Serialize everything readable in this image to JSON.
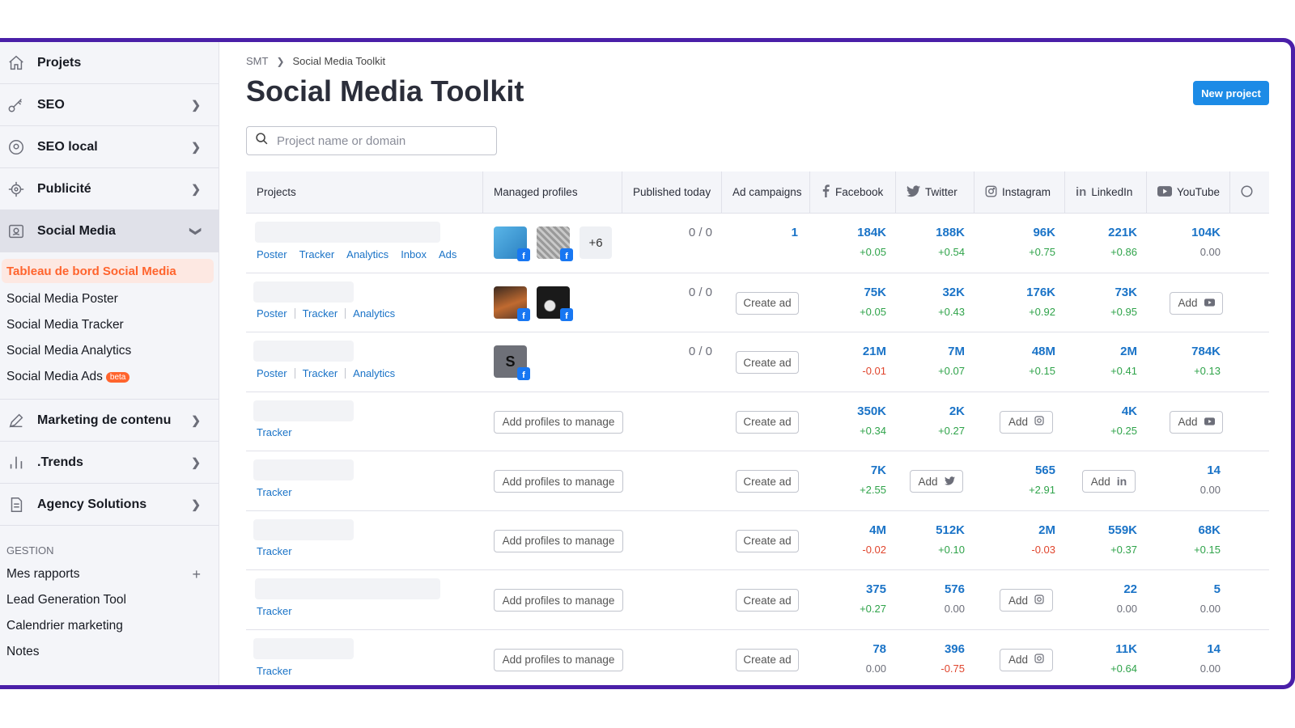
{
  "sidebar": {
    "items": [
      {
        "label": "Projets",
        "icon": "home-icon"
      },
      {
        "label": "SEO",
        "icon": "key-icon"
      },
      {
        "label": "SEO local",
        "icon": "location-pin-icon"
      },
      {
        "label": "Publicité",
        "icon": "target-icon"
      },
      {
        "label": "Social Media",
        "icon": "social-icon"
      }
    ],
    "social_sub": {
      "active": "Tableau de bord Social Media",
      "items": [
        "Social Media Poster",
        "Social Media Tracker",
        "Social Media Analytics",
        "Social Media Ads"
      ],
      "beta": "beta"
    },
    "items2": [
      {
        "label": "Marketing de contenu",
        "icon": "pencil-icon"
      },
      {
        "label": ".Trends",
        "icon": "bars-icon"
      },
      {
        "label": "Agency Solutions",
        "icon": "document-icon"
      }
    ],
    "gestion_label": "GESTION",
    "gestion_items": [
      "Mes rapports",
      "Lead Generation Tool",
      "Calendrier marketing",
      "Notes"
    ]
  },
  "breadcrumb": {
    "root": "SMT",
    "current": "Social Media Toolkit"
  },
  "page_title": "Social Media Toolkit",
  "new_project": "New project",
  "search": {
    "placeholder": "Project name or domain"
  },
  "table": {
    "headers": {
      "projects": "Projects",
      "managed": "Managed profiles",
      "published": "Published today",
      "ads": "Ad campaigns",
      "facebook": "Facebook",
      "twitter": "Twitter",
      "instagram": "Instagram",
      "linkedin": "LinkedIn",
      "youtube": "YouTube"
    },
    "labels": {
      "create_ad": "Create ad",
      "add_profiles": "Add profiles to manage",
      "add": "Add",
      "more": "+6"
    },
    "rows": [
      {
        "links": [
          "Poster",
          "Tracker",
          "Analytics",
          "Inbox",
          "Ads"
        ],
        "published": "0 / 0",
        "ads": "1",
        "fb": [
          "184K",
          "+0.05"
        ],
        "tw": [
          "188K",
          "+0.54"
        ],
        "ig": [
          "96K",
          "+0.75"
        ],
        "li": [
          "221K",
          "+0.86"
        ],
        "yt": [
          "104K",
          "0.00"
        ]
      },
      {
        "links": [
          "Poster",
          "Tracker",
          "Analytics"
        ],
        "published": "0 / 0",
        "fb": [
          "75K",
          "+0.05"
        ],
        "tw": [
          "32K",
          "+0.43"
        ],
        "ig": [
          "176K",
          "+0.92"
        ],
        "li": [
          "73K",
          "+0.95"
        ]
      },
      {
        "links": [
          "Poster",
          "Tracker",
          "Analytics"
        ],
        "published": "0 / 0",
        "fb": [
          "21M",
          "-0.01"
        ],
        "tw": [
          "7M",
          "+0.07"
        ],
        "ig": [
          "48M",
          "+0.15"
        ],
        "li": [
          "2M",
          "+0.41"
        ],
        "yt": [
          "784K",
          "+0.13"
        ]
      },
      {
        "links": [
          "Tracker"
        ],
        "fb": [
          "350K",
          "+0.34"
        ],
        "tw": [
          "2K",
          "+0.27"
        ],
        "li": [
          "4K",
          "+0.25"
        ]
      },
      {
        "links": [
          "Tracker"
        ],
        "fb": [
          "7K",
          "+2.55"
        ],
        "ig": [
          "565",
          "+2.91"
        ],
        "yt": [
          "14",
          "0.00"
        ]
      },
      {
        "links": [
          "Tracker"
        ],
        "fb": [
          "4M",
          "-0.02"
        ],
        "tw": [
          "512K",
          "+0.10"
        ],
        "ig": [
          "2M",
          "-0.03"
        ],
        "li": [
          "559K",
          "+0.37"
        ],
        "yt": [
          "68K",
          "+0.15"
        ]
      },
      {
        "links": [
          "Tracker"
        ],
        "fb": [
          "375",
          "+0.27"
        ],
        "tw": [
          "576",
          "0.00"
        ],
        "li": [
          "22",
          "0.00"
        ],
        "yt": [
          "5",
          "0.00"
        ]
      },
      {
        "links": [
          "Tracker"
        ],
        "fb": [
          "78",
          "0.00"
        ],
        "tw": [
          "396",
          "-0.75"
        ],
        "li": [
          "11K",
          "+0.64"
        ],
        "yt": [
          "14",
          "0.00"
        ]
      }
    ]
  },
  "colors": {
    "accent": "#1c8be6",
    "link": "#1a73c7",
    "brand_orange": "#ff642d",
    "frame": "#4a1fa8",
    "positive": "#2fa34a",
    "negative": "#e0452d"
  }
}
